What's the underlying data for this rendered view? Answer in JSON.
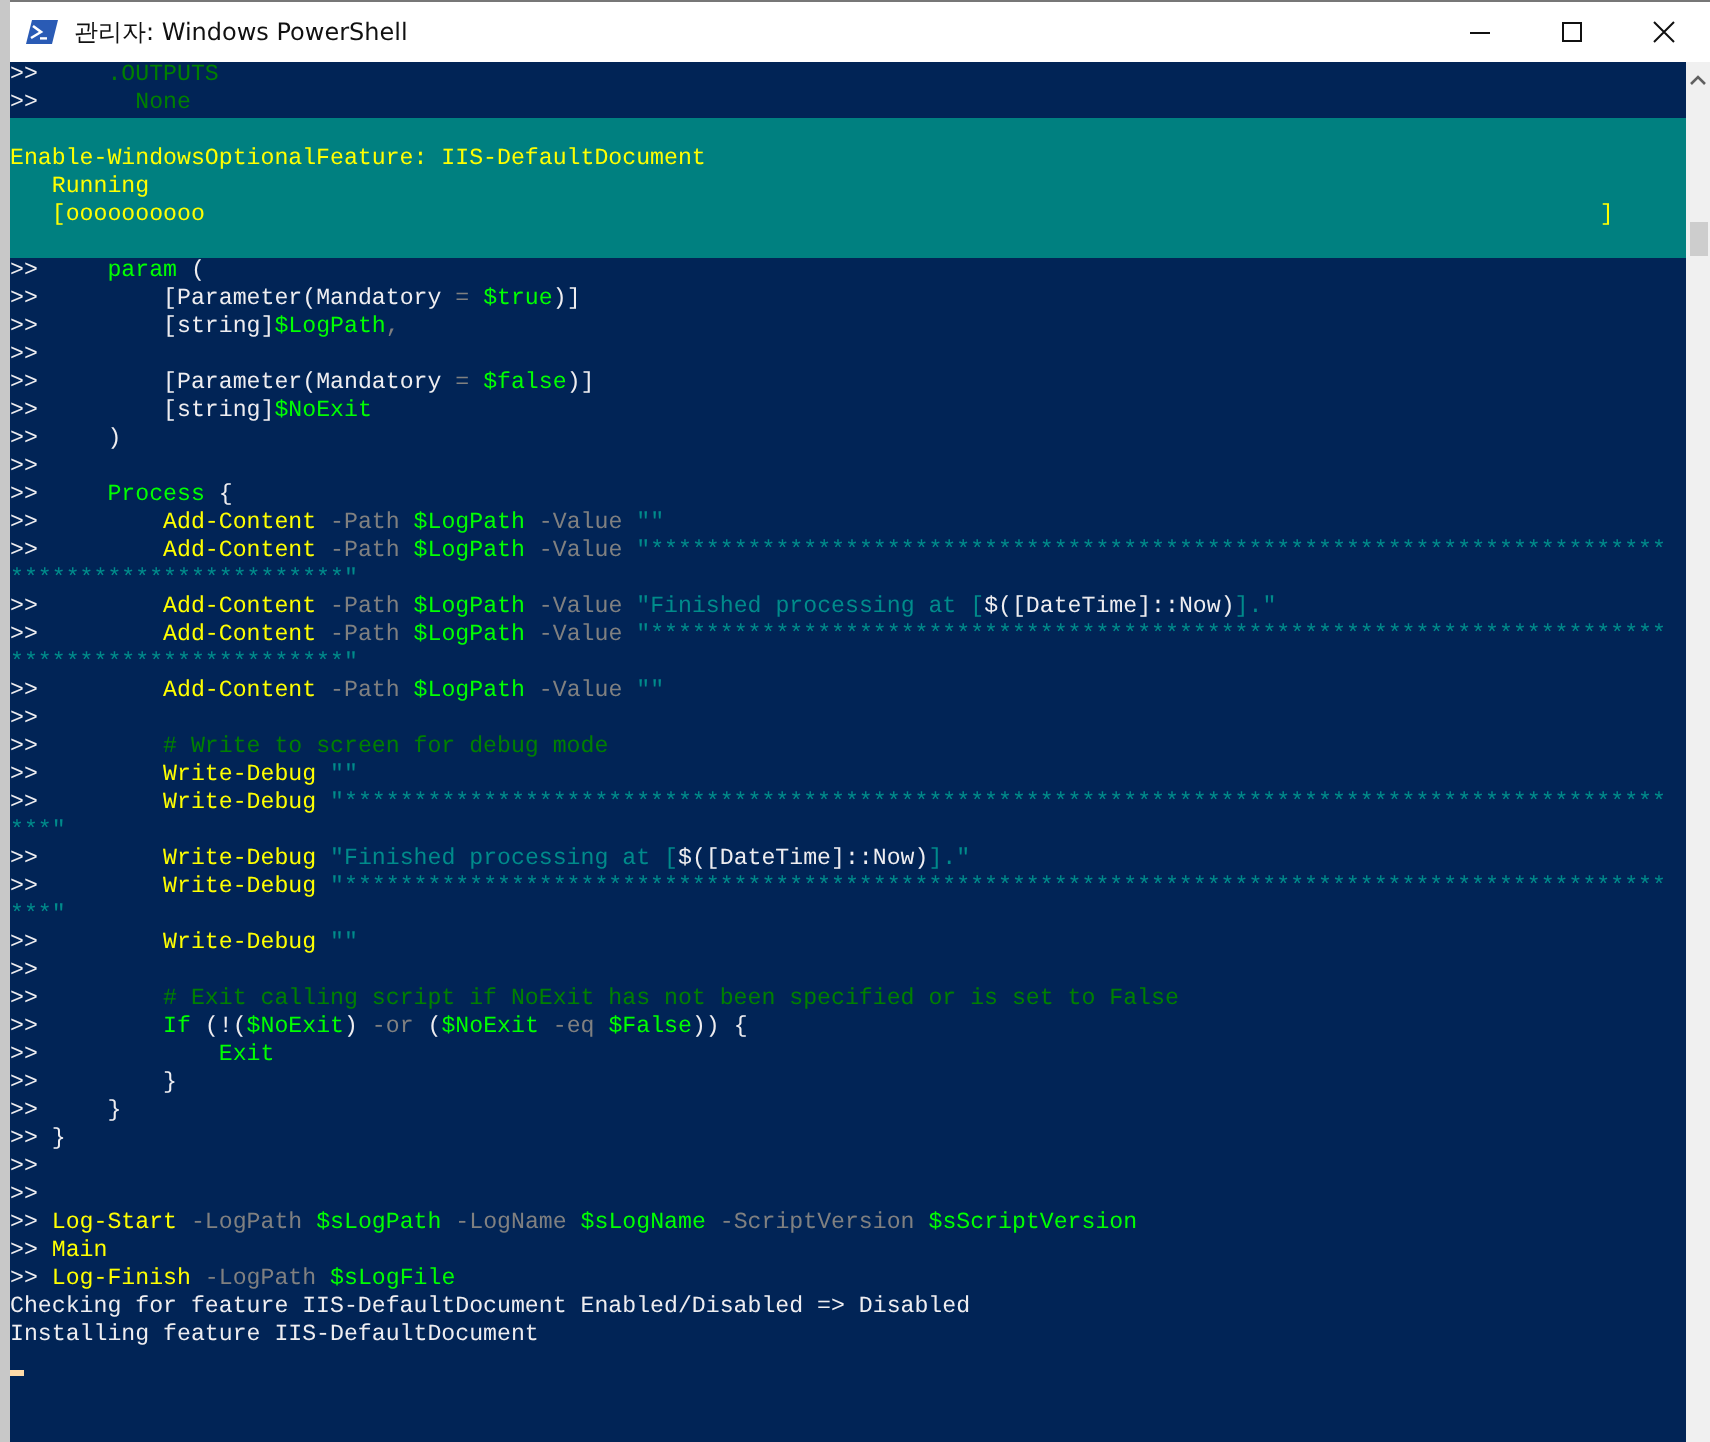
{
  "window": {
    "title": "관리자: Windows PowerShell"
  },
  "console": {
    "lines_before": [
      {
        "segments": [
          {
            "kind": "prompt",
            "text": ">>"
          },
          {
            "kind": "comment",
            "text": "     .OUTPUTS"
          }
        ]
      },
      {
        "segments": [
          {
            "kind": "prompt",
            "text": ">>"
          },
          {
            "kind": "comment",
            "text": "       None"
          }
        ]
      }
    ],
    "progress": {
      "activity": "Enable-WindowsOptionalFeature: IIS-DefaultDocument",
      "status": "Running",
      "bar_start": "[oooooooooo",
      "bar_end": "]"
    },
    "lines": [
      {
        "segments": [
          {
            "kind": "prompt",
            "text": ">>"
          },
          {
            "kind": "variable",
            "text": "     param"
          },
          {
            "kind": "plain",
            "text": " ("
          }
        ]
      },
      {
        "segments": [
          {
            "kind": "prompt",
            "text": ">>"
          },
          {
            "kind": "plain",
            "text": "         [Parameter(Mandatory"
          },
          {
            "kind": "param",
            "text": " = "
          },
          {
            "kind": "variable",
            "text": "$true"
          },
          {
            "kind": "plain",
            "text": ")]"
          }
        ]
      },
      {
        "segments": [
          {
            "kind": "prompt",
            "text": ">>"
          },
          {
            "kind": "plain",
            "text": "         [string]"
          },
          {
            "kind": "variable",
            "text": "$LogPath"
          },
          {
            "kind": "param",
            "text": ","
          }
        ]
      },
      {
        "segments": [
          {
            "kind": "prompt",
            "text": ">>"
          }
        ]
      },
      {
        "segments": [
          {
            "kind": "prompt",
            "text": ">>"
          },
          {
            "kind": "plain",
            "text": "         [Parameter(Mandatory"
          },
          {
            "kind": "param",
            "text": " = "
          },
          {
            "kind": "variable",
            "text": "$false"
          },
          {
            "kind": "plain",
            "text": ")]"
          }
        ]
      },
      {
        "segments": [
          {
            "kind": "prompt",
            "text": ">>"
          },
          {
            "kind": "plain",
            "text": "         [string]"
          },
          {
            "kind": "variable",
            "text": "$NoExit"
          }
        ]
      },
      {
        "segments": [
          {
            "kind": "prompt",
            "text": ">>"
          },
          {
            "kind": "plain",
            "text": "     )"
          }
        ]
      },
      {
        "segments": [
          {
            "kind": "prompt",
            "text": ">>"
          }
        ]
      },
      {
        "segments": [
          {
            "kind": "prompt",
            "text": ">>"
          },
          {
            "kind": "variable",
            "text": "     Process"
          },
          {
            "kind": "plain",
            "text": " {"
          }
        ]
      },
      {
        "segments": [
          {
            "kind": "prompt",
            "text": ">>"
          },
          {
            "kind": "keyword",
            "text": "         Add-Content"
          },
          {
            "kind": "param",
            "text": " -Path "
          },
          {
            "kind": "variable",
            "text": "$LogPath"
          },
          {
            "kind": "param",
            "text": " -Value "
          },
          {
            "kind": "string",
            "text": "\"\""
          }
        ]
      },
      {
        "segments": [
          {
            "kind": "prompt",
            "text": ">>"
          },
          {
            "kind": "keyword",
            "text": "         Add-Content"
          },
          {
            "kind": "param",
            "text": " -Path "
          },
          {
            "kind": "variable",
            "text": "$LogPath"
          },
          {
            "kind": "param",
            "text": " -Value "
          },
          {
            "kind": "string",
            "text": "\"*************************************************************************"
          }
        ]
      },
      {
        "segments": [
          {
            "kind": "string",
            "text": "************************\""
          }
        ]
      },
      {
        "segments": [
          {
            "kind": "prompt",
            "text": ">>"
          },
          {
            "kind": "keyword",
            "text": "         Add-Content"
          },
          {
            "kind": "param",
            "text": " -Path "
          },
          {
            "kind": "variable",
            "text": "$LogPath"
          },
          {
            "kind": "param",
            "text": " -Value "
          },
          {
            "kind": "string",
            "text": "\"Finished processing at ["
          },
          {
            "kind": "plain",
            "text": "$([DateTime]::Now)"
          },
          {
            "kind": "string",
            "text": "].\""
          }
        ]
      },
      {
        "segments": [
          {
            "kind": "prompt",
            "text": ">>"
          },
          {
            "kind": "keyword",
            "text": "         Add-Content"
          },
          {
            "kind": "param",
            "text": " -Path "
          },
          {
            "kind": "variable",
            "text": "$LogPath"
          },
          {
            "kind": "param",
            "text": " -Value "
          },
          {
            "kind": "string",
            "text": "\"*************************************************************************"
          }
        ]
      },
      {
        "segments": [
          {
            "kind": "string",
            "text": "************************\""
          }
        ]
      },
      {
        "segments": [
          {
            "kind": "prompt",
            "text": ">>"
          },
          {
            "kind": "keyword",
            "text": "         Add-Content"
          },
          {
            "kind": "param",
            "text": " -Path "
          },
          {
            "kind": "variable",
            "text": "$LogPath"
          },
          {
            "kind": "param",
            "text": " -Value "
          },
          {
            "kind": "string",
            "text": "\"\""
          }
        ]
      },
      {
        "segments": [
          {
            "kind": "prompt",
            "text": ">>"
          }
        ]
      },
      {
        "segments": [
          {
            "kind": "prompt",
            "text": ">>"
          },
          {
            "kind": "comment",
            "text": "         # Write to screen for debug mode"
          }
        ]
      },
      {
        "segments": [
          {
            "kind": "prompt",
            "text": ">>"
          },
          {
            "kind": "keyword",
            "text": "         Write-Debug"
          },
          {
            "kind": "string",
            "text": " \"\""
          }
        ]
      },
      {
        "segments": [
          {
            "kind": "prompt",
            "text": ">>"
          },
          {
            "kind": "keyword",
            "text": "         Write-Debug"
          },
          {
            "kind": "string",
            "text": " \"***********************************************************************************************"
          }
        ]
      },
      {
        "segments": [
          {
            "kind": "string",
            "text": "***\""
          }
        ]
      },
      {
        "segments": [
          {
            "kind": "prompt",
            "text": ">>"
          },
          {
            "kind": "keyword",
            "text": "         Write-Debug"
          },
          {
            "kind": "string",
            "text": " \"Finished processing at ["
          },
          {
            "kind": "plain",
            "text": "$([DateTime]::Now)"
          },
          {
            "kind": "string",
            "text": "].\""
          }
        ]
      },
      {
        "segments": [
          {
            "kind": "prompt",
            "text": ">>"
          },
          {
            "kind": "keyword",
            "text": "         Write-Debug"
          },
          {
            "kind": "string",
            "text": " \"***********************************************************************************************"
          }
        ]
      },
      {
        "segments": [
          {
            "kind": "string",
            "text": "***\""
          }
        ]
      },
      {
        "segments": [
          {
            "kind": "prompt",
            "text": ">>"
          },
          {
            "kind": "keyword",
            "text": "         Write-Debug"
          },
          {
            "kind": "string",
            "text": " \"\""
          }
        ]
      },
      {
        "segments": [
          {
            "kind": "prompt",
            "text": ">>"
          }
        ]
      },
      {
        "segments": [
          {
            "kind": "prompt",
            "text": ">>"
          },
          {
            "kind": "comment",
            "text": "         # Exit calling script if NoExit has not been specified or is set to False"
          }
        ]
      },
      {
        "segments": [
          {
            "kind": "prompt",
            "text": ">>"
          },
          {
            "kind": "variable",
            "text": "         If"
          },
          {
            "kind": "plain",
            "text": " (!("
          },
          {
            "kind": "variable",
            "text": "$NoExit"
          },
          {
            "kind": "plain",
            "text": ") "
          },
          {
            "kind": "param",
            "text": "-or"
          },
          {
            "kind": "plain",
            "text": " ("
          },
          {
            "kind": "variable",
            "text": "$NoExit"
          },
          {
            "kind": "param",
            "text": " -eq "
          },
          {
            "kind": "variable",
            "text": "$False"
          },
          {
            "kind": "plain",
            "text": ")) {"
          }
        ]
      },
      {
        "segments": [
          {
            "kind": "prompt",
            "text": ">>"
          },
          {
            "kind": "variable",
            "text": "             Exit"
          }
        ]
      },
      {
        "segments": [
          {
            "kind": "prompt",
            "text": ">>"
          },
          {
            "kind": "plain",
            "text": "         }"
          }
        ]
      },
      {
        "segments": [
          {
            "kind": "prompt",
            "text": ">>"
          },
          {
            "kind": "plain",
            "text": "     }"
          }
        ]
      },
      {
        "segments": [
          {
            "kind": "prompt",
            "text": ">>"
          },
          {
            "kind": "plain",
            "text": " }"
          }
        ]
      },
      {
        "segments": [
          {
            "kind": "prompt",
            "text": ">>"
          }
        ]
      },
      {
        "segments": [
          {
            "kind": "prompt",
            "text": ">>"
          }
        ]
      },
      {
        "segments": [
          {
            "kind": "prompt",
            "text": ">>"
          },
          {
            "kind": "keyword",
            "text": " Log-Start"
          },
          {
            "kind": "param",
            "text": " -LogPath "
          },
          {
            "kind": "variable",
            "text": "$sLogPath"
          },
          {
            "kind": "param",
            "text": " -LogName "
          },
          {
            "kind": "variable",
            "text": "$sLogName"
          },
          {
            "kind": "param",
            "text": " -ScriptVersion "
          },
          {
            "kind": "variable",
            "text": "$sScriptVersion"
          }
        ]
      },
      {
        "segments": [
          {
            "kind": "prompt",
            "text": ">>"
          },
          {
            "kind": "keyword",
            "text": " Main"
          }
        ]
      },
      {
        "segments": [
          {
            "kind": "prompt",
            "text": ">>"
          },
          {
            "kind": "keyword",
            "text": " Log-Finish"
          },
          {
            "kind": "param",
            "text": " -LogPath "
          },
          {
            "kind": "variable",
            "text": "$sLogFile"
          }
        ]
      },
      {
        "segments": [
          {
            "kind": "output",
            "text": "Checking for feature IIS-DefaultDocument Enabled/Disabled => Disabled"
          }
        ]
      },
      {
        "segments": [
          {
            "kind": "output",
            "text": "Installing feature IIS-DefaultDocument"
          }
        ]
      }
    ]
  }
}
